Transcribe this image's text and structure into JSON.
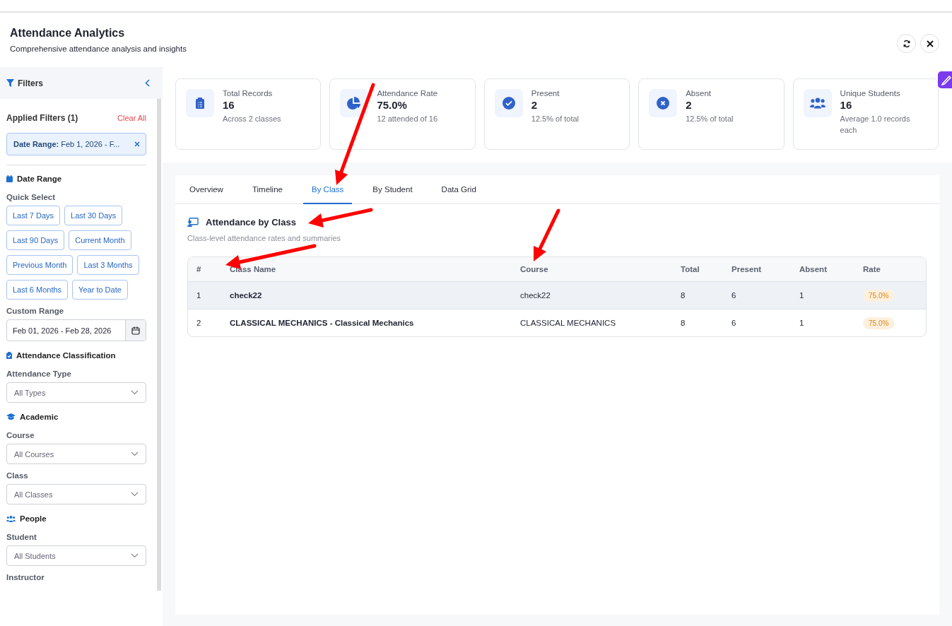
{
  "header": {
    "title": "Attendance Analytics",
    "subtitle": "Comprehensive attendance analysis and insights"
  },
  "filters": {
    "title": "Filters",
    "applied_title": "Applied Filters (1)",
    "clear_label": "Clear All",
    "chips": [
      {
        "label": "Date Range:",
        "value": "Feb 1, 2026 - F..."
      }
    ],
    "sections": [
      {
        "title": "Date Range",
        "fields": [
          {
            "kind": "quick",
            "label": "Quick Select",
            "options": [
              "Last 7 Days",
              "Last 30 Days",
              "Last 90 Days",
              "Current Month",
              "Previous Month",
              "Last 3 Months",
              "Last 6 Months",
              "Year to Date"
            ]
          },
          {
            "kind": "date",
            "label": "Custom Range",
            "value": "Feb 01, 2026 - Feb 28, 2026"
          }
        ]
      },
      {
        "title": "Attendance Classification",
        "fields": [
          {
            "kind": "dropdown",
            "label": "Attendance Type",
            "value": "All Types"
          }
        ]
      },
      {
        "title": "Academic",
        "fields": [
          {
            "kind": "dropdown",
            "label": "Course",
            "value": "All Courses"
          },
          {
            "kind": "dropdown",
            "label": "Class",
            "value": "All Classes"
          }
        ]
      },
      {
        "title": "People",
        "fields": [
          {
            "kind": "dropdown",
            "label": "Student",
            "value": "All Students"
          },
          {
            "kind": "label",
            "label": "Instructor"
          }
        ]
      }
    ]
  },
  "stats": [
    {
      "label": "Total Records",
      "value": "16",
      "note": "Across 2 classes"
    },
    {
      "label": "Attendance Rate",
      "value": "75.0%",
      "note": "12 attended of 16"
    },
    {
      "label": "Present",
      "value": "2",
      "note": "12.5% of total"
    },
    {
      "label": "Absent",
      "value": "2",
      "note": "12.5% of total"
    },
    {
      "label": "Unique Students",
      "value": "16",
      "note": "Average 1.0 records each"
    }
  ],
  "tabs": [
    {
      "label": "Overview",
      "selected": false
    },
    {
      "label": "Timeline",
      "selected": false
    },
    {
      "label": "By Class",
      "selected": true
    },
    {
      "label": "By Student",
      "selected": false
    },
    {
      "label": "Data Grid",
      "selected": false
    }
  ],
  "section": {
    "title": "Attendance by Class",
    "subtitle": "Class-level attendance rates and summaries"
  },
  "table": {
    "columns": [
      "#",
      "Class Name",
      "Course",
      "Total",
      "Present",
      "Absent",
      "Rate"
    ],
    "rows": [
      {
        "selected": true,
        "cells": [
          "1",
          "check22",
          "check22",
          "8",
          "6",
          "1",
          "75.0%"
        ]
      },
      {
        "selected": false,
        "cells": [
          "2",
          "CLASSICAL MECHANICS - Classical Mechanics",
          "CLASSICAL MECHANICS",
          "8",
          "6",
          "1",
          "75.0%"
        ]
      }
    ]
  }
}
